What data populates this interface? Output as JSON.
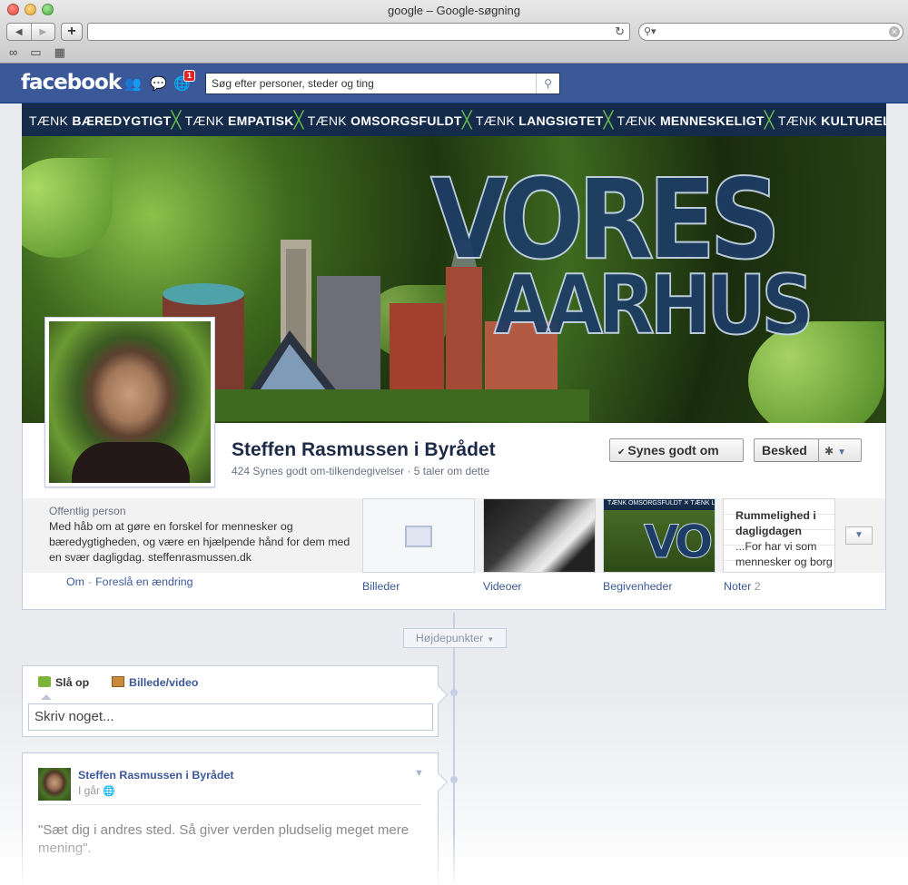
{
  "browser": {
    "window_title": "google – Google-søgning",
    "url": "",
    "search_value": "",
    "bookmark_icons": [
      "reading-list-icon",
      "bookmarks-icon",
      "top-sites-icon"
    ]
  },
  "fb": {
    "logo": "facebook",
    "notif_count": "1",
    "search_placeholder": "Søg efter personer, steder og ting",
    "icons": [
      "friends-icon",
      "messages-icon",
      "notifications-icon",
      "search-icon"
    ]
  },
  "cover": {
    "tagline": [
      {
        "pre": "TÆNK",
        "word": "BÆREDYGTIGT"
      },
      {
        "pre": "TÆNK",
        "word": "EMPATISK"
      },
      {
        "pre": "TÆNK",
        "word": "OMSORGSFULDT"
      },
      {
        "pre": "TÆNK",
        "word": "LANGSIGTET"
      },
      {
        "pre": "TÆNK",
        "word": "MENNESKELIGT"
      },
      {
        "pre": "TÆNK",
        "word": "KULTURELT"
      }
    ],
    "art_line1": "VORES",
    "art_line2": "AARHUS"
  },
  "profile": {
    "name": "Steffen Rasmussen i Byrådet",
    "subtitle": "424 Synes godt om-tilkendegivelser · 5 taler om dette",
    "like_button": "Synes godt om",
    "message_button": "Besked",
    "category": "Offentlig person",
    "about": "Med håb om at gøre en forskel for mennesker og bæredygtigheden, og være en hjælpende hånd for dem med en svær dagligdag. steffenrasmussen.dk",
    "about_link": "Om",
    "suggest_link": "Foreslå en ændring"
  },
  "tiles": {
    "photos": "Billeder",
    "videos": "Videoer",
    "events": "Begivenheder",
    "notes": "Noter",
    "notes_count": "2",
    "note_title": "Rummelighed i dagligdagen",
    "note_body1": "...For har vi som",
    "note_body2": "mennesker og borg",
    "events_strip": "TÆNK OMSORGSFULDT ✕ TÆNK LANGSIGTET",
    "events_art": "VO"
  },
  "timeline": {
    "highlights": "Højdepunkter"
  },
  "composer": {
    "tab_status": "Slå op",
    "tab_photo": "Billede/video",
    "placeholder": "Skriv noget..."
  },
  "post": {
    "author": "Steffen Rasmussen i Byrådet",
    "time": "I går",
    "text": "\"Sæt dig i andres sted. Så giver verden pludselig meget mere mening\"."
  }
}
